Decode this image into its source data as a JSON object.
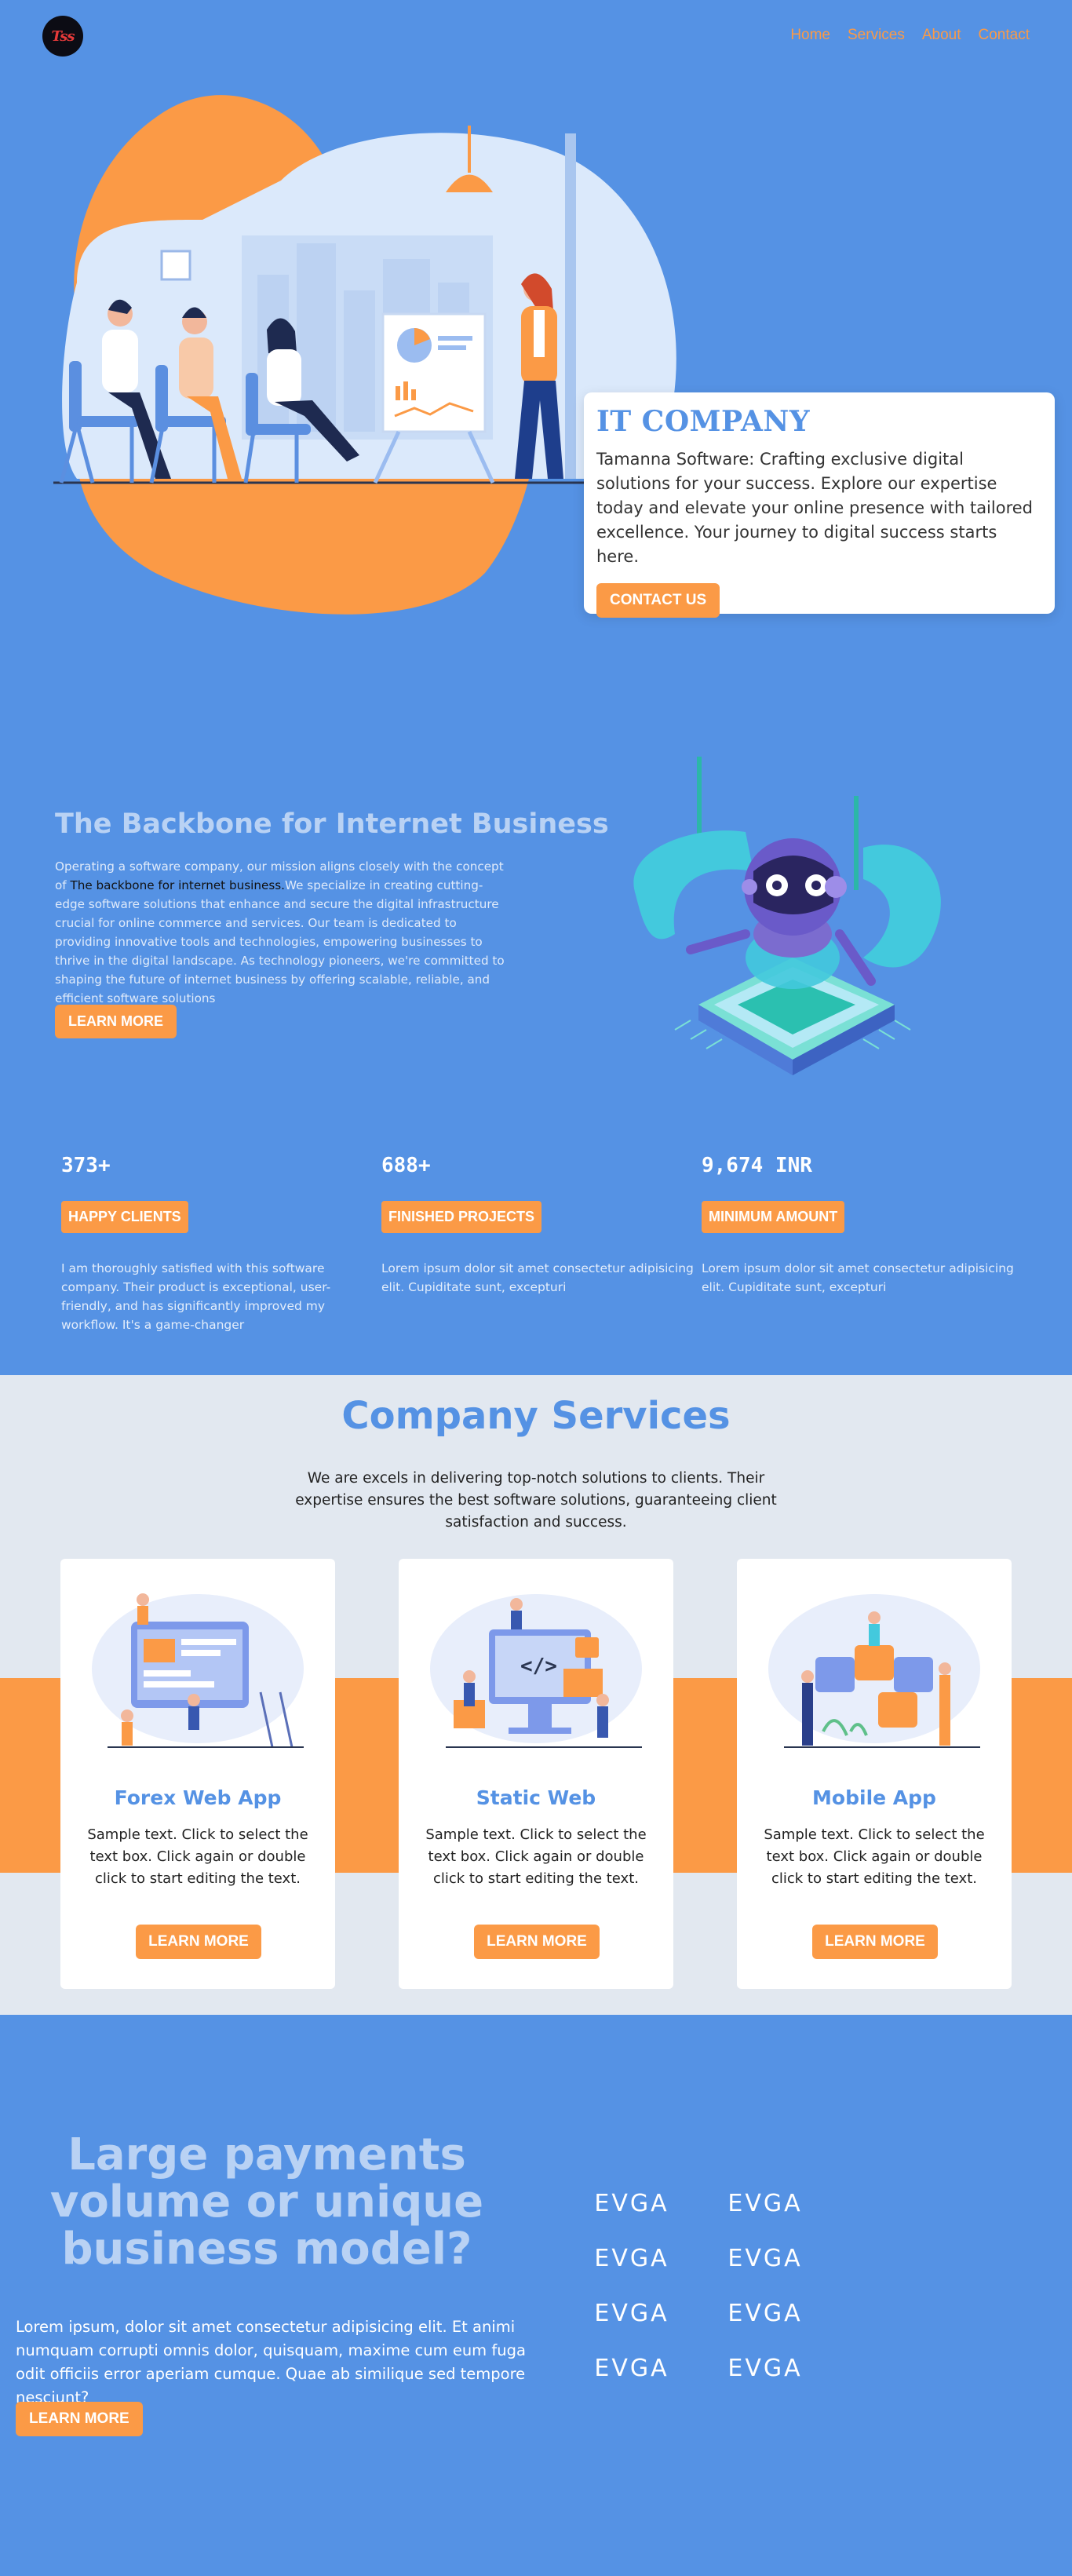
{
  "nav": {
    "logo_text": "Tss",
    "links": [
      "Home",
      "Services",
      "About",
      "Contact"
    ]
  },
  "hero": {
    "title": "IT COMPANY",
    "description": "Tamanna Software: Crafting exclusive digital solutions for your success. Explore our expertise today and elevate your online presence with tailored excellence. Your journey to digital success starts here.",
    "button": "CONTACT US"
  },
  "backbone": {
    "title": "The Backbone for Internet Business",
    "text_before": "Operating a software company, our mission aligns closely with the concept of ",
    "text_highlight": "The backbone for internet business.",
    "text_after": "We specialize in creating cutting-edge software solutions that enhance and secure the digital infrastructure crucial for online commerce and services. Our team is dedicated to providing innovative tools and technologies, empowering businesses to thrive in the digital landscape. As technology pioneers, we're committed to shaping the future of internet business by offering scalable, reliable, and efficient software solutions",
    "button": "LEARN MORE"
  },
  "stats": [
    {
      "number": "373+",
      "label": "HAPPY CLIENTS",
      "desc": "I am thoroughly satisfied with this software company. Their product is exceptional, user-friendly, and has significantly improved my workflow. It's a game-changer"
    },
    {
      "number": "688+",
      "label": "FINISHED PROJECTS",
      "desc": "Lorem ipsum dolor sit amet consectetur adipisicing elit. Cupiditate sunt, excepturi"
    },
    {
      "number": "9,674 INR",
      "label": "MINIMUM AMOUNT",
      "desc": "Lorem ipsum dolor sit amet consectetur adipisicing elit. Cupiditate sunt, excepturi"
    }
  ],
  "services": {
    "title": "Company Services",
    "subtitle": "We are excels in delivering top-notch solutions to clients. Their expertise ensures the best software solutions, guaranteeing client satisfaction and success.",
    "cards": [
      {
        "title": "Forex Web App",
        "text": "Sample text. Click to select the text box. Click again or double click to start editing the text.",
        "button": "LEARN MORE"
      },
      {
        "title": "Static Web",
        "text": "Sample text. Click to select the text box. Click again or double click to start editing the text.",
        "button": "LEARN MORE"
      },
      {
        "title": "Mobile App",
        "text": "Sample text. Click to select the text box. Click again or double click to start editing the text.",
        "button": "LEARN MORE"
      }
    ]
  },
  "payments": {
    "title": "Large payments volume or unique business model?",
    "text": "Lorem ipsum, dolor sit amet consectetur adipisicing elit. Et animi numquam corrupti omnis dolor, quisquam, maxime cum eum fuga odit officiis error aperiam cumque. Quae ab similique sed tempore nesciunt?",
    "button": "LEARN MORE",
    "partner_logo": "EVGA"
  },
  "colors": {
    "background": "#5592e4",
    "accent": "#fb9a46",
    "light": "#e2e8f0"
  }
}
